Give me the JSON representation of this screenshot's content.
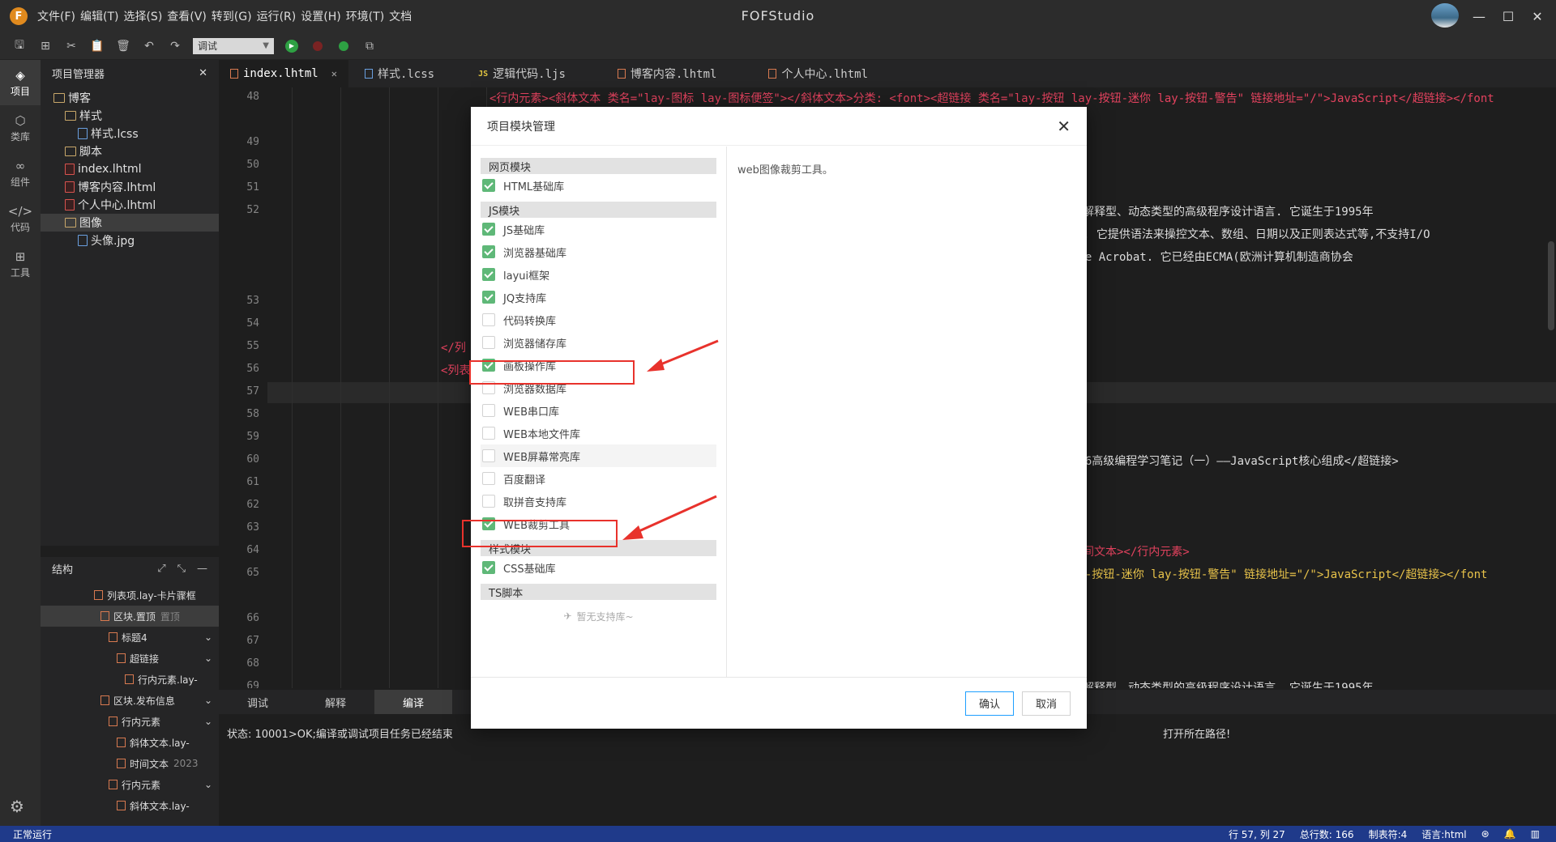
{
  "titlebar": {
    "logo": "F",
    "menu": [
      "文件(F)",
      "编辑(T)",
      "选择(S)",
      "查看(V)",
      "转到(G)",
      "运行(R)",
      "设置(H)",
      "环境(T)",
      "文档"
    ],
    "title": "FOFStudio"
  },
  "toolbar": {
    "mode": "调试",
    "run_color": "#2ea043",
    "stop_color": "#d73a49",
    "status_color": "#2ea043"
  },
  "activity": [
    {
      "label": "项目",
      "icon": "layers-icon"
    },
    {
      "label": "类库",
      "icon": "package-icon"
    },
    {
      "label": "组件",
      "icon": "link-icon"
    },
    {
      "label": "代码",
      "icon": "code-icon"
    },
    {
      "label": "工具",
      "icon": "grid-icon"
    }
  ],
  "explorer": {
    "title": "项目管理器",
    "items": [
      {
        "label": "博客",
        "type": "folder",
        "indent": 0
      },
      {
        "label": "样式",
        "type": "folder",
        "indent": 1
      },
      {
        "label": "样式.lcss",
        "type": "doc",
        "indent": 2
      },
      {
        "label": "脚本",
        "type": "folder",
        "indent": 1
      },
      {
        "label": "index.lhtml",
        "type": "file",
        "indent": 1
      },
      {
        "label": "博客内容.lhtml",
        "type": "file",
        "indent": 1
      },
      {
        "label": "个人中心.lhtml",
        "type": "file",
        "indent": 1
      },
      {
        "label": "图像",
        "type": "folder",
        "indent": 1
      },
      {
        "label": "头像.jpg",
        "type": "doc",
        "indent": 2
      }
    ]
  },
  "structure": {
    "title": "结构",
    "rows": [
      {
        "label": "列表项.lay-卡片骤框",
        "sub": ""
      },
      {
        "label": "区块.置顶",
        "sub": "置顶"
      },
      {
        "label": "标题4",
        "sub": ""
      },
      {
        "label": "超链接",
        "sub": ""
      },
      {
        "label": "行内元素.lay-",
        "sub": ""
      },
      {
        "label": "区块.发布信息",
        "sub": ""
      },
      {
        "label": "行内元素",
        "sub": ""
      },
      {
        "label": "斜体文本.lay-",
        "sub": ""
      },
      {
        "label": "时间文本",
        "sub": "2023"
      },
      {
        "label": "行内元素",
        "sub": ""
      },
      {
        "label": "斜体文本.lay-",
        "sub": ""
      }
    ]
  },
  "tabs": [
    {
      "label": "index.lhtml",
      "active": true
    },
    {
      "label": "样式.lcss",
      "active": false
    },
    {
      "label": "逻辑代码.ljs",
      "active": false
    },
    {
      "label": "博客内容.lhtml",
      "active": false
    },
    {
      "label": "个人中心.lhtml",
      "active": false
    }
  ],
  "editor": {
    "lines": [
      {
        "n": "48"
      },
      {
        "n": "49"
      },
      {
        "n": "50"
      },
      {
        "n": "51"
      },
      {
        "n": "52"
      },
      {
        "n": "53"
      },
      {
        "n": "54"
      },
      {
        "n": "55"
      },
      {
        "n": "56"
      },
      {
        "n": "57"
      },
      {
        "n": "58"
      },
      {
        "n": "59"
      },
      {
        "n": "60"
      },
      {
        "n": "61"
      },
      {
        "n": "62"
      },
      {
        "n": "63"
      },
      {
        "n": "64"
      },
      {
        "n": "65"
      },
      {
        "n": "66"
      },
      {
        "n": "67"
      },
      {
        "n": "68"
      },
      {
        "n": "69"
      }
    ],
    "code48_a": "<行内元素><斜体文本 类名=\"lay-图标 lay-图标便签\"></斜体文本>分类: <font><超链接 类名=\"lay-按钮 lay-按钮-迷你 lay-按钮-警告\" 链接地址=\"/\">JavaScript</超链接></font",
    "code52_a": "、解释型、动态类型的高级程序设计语言. 它诞生于1995年",
    "code52_b": "程. 它提供语法来操控文本、数组、日期以及正则表达式等,不支持I/O",
    "code52_c": "obe Acrobat. 它已经由ECMA(欧洲计算机制造商协会",
    "code55": "</列",
    "code56": "<列表",
    "code60": "ES6高级编程学习笔记（一）——JavaScript核心组成</超链接>",
    "code64": "时间文本></行内元素>",
    "code65": "ay-按钮-迷你 lay-按钮-警告\" 链接地址=\"/\">JavaScript</超链接></font",
    "code69": "、解释型、动态类型的高级程序设计语言. 它诞生于1995年"
  },
  "panel": {
    "tabs": [
      "调试",
      "解释",
      "编译"
    ],
    "active": "编译",
    "status": "状态: 10001>OK;编译或调试项目任务已经结束",
    "status_tail": "打开所在路径!"
  },
  "statusbar": {
    "left": "正常运行",
    "pos": "行 57, 列 27",
    "total": "总行数: 166",
    "tab": "制表符:4",
    "lang": "语言:html"
  },
  "dialog": {
    "title": "项目模块管理",
    "description": "web图像裁剪工具。",
    "groups": [
      {
        "name": "网页模块",
        "items": [
          {
            "label": "HTML基础库",
            "checked": true
          }
        ]
      },
      {
        "name": "JS模块",
        "items": [
          {
            "label": "JS基础库",
            "checked": true
          },
          {
            "label": "浏览器基础库",
            "checked": true
          },
          {
            "label": "layui框架",
            "checked": true
          },
          {
            "label": "JQ支持库",
            "checked": true
          },
          {
            "label": "代码转换库",
            "checked": false
          },
          {
            "label": "浏览器储存库",
            "checked": false
          },
          {
            "label": "画板操作库",
            "checked": true
          },
          {
            "label": "浏览器数据库",
            "checked": false
          },
          {
            "label": "WEB串口库",
            "checked": false
          },
          {
            "label": "WEB本地文件库",
            "checked": false
          },
          {
            "label": "WEB屏幕常亮库",
            "checked": false,
            "hl": true
          },
          {
            "label": "百度翻译",
            "checked": false
          },
          {
            "label": "取拼音支持库",
            "checked": false
          },
          {
            "label": "WEB裁剪工具",
            "checked": true
          }
        ]
      },
      {
        "name": "样式模块",
        "items": [
          {
            "label": "CSS基础库",
            "checked": true
          }
        ]
      },
      {
        "name": "TS脚本",
        "items": []
      }
    ],
    "empty_note": "暂无支持库~",
    "confirm": "确认",
    "cancel": "取消"
  }
}
